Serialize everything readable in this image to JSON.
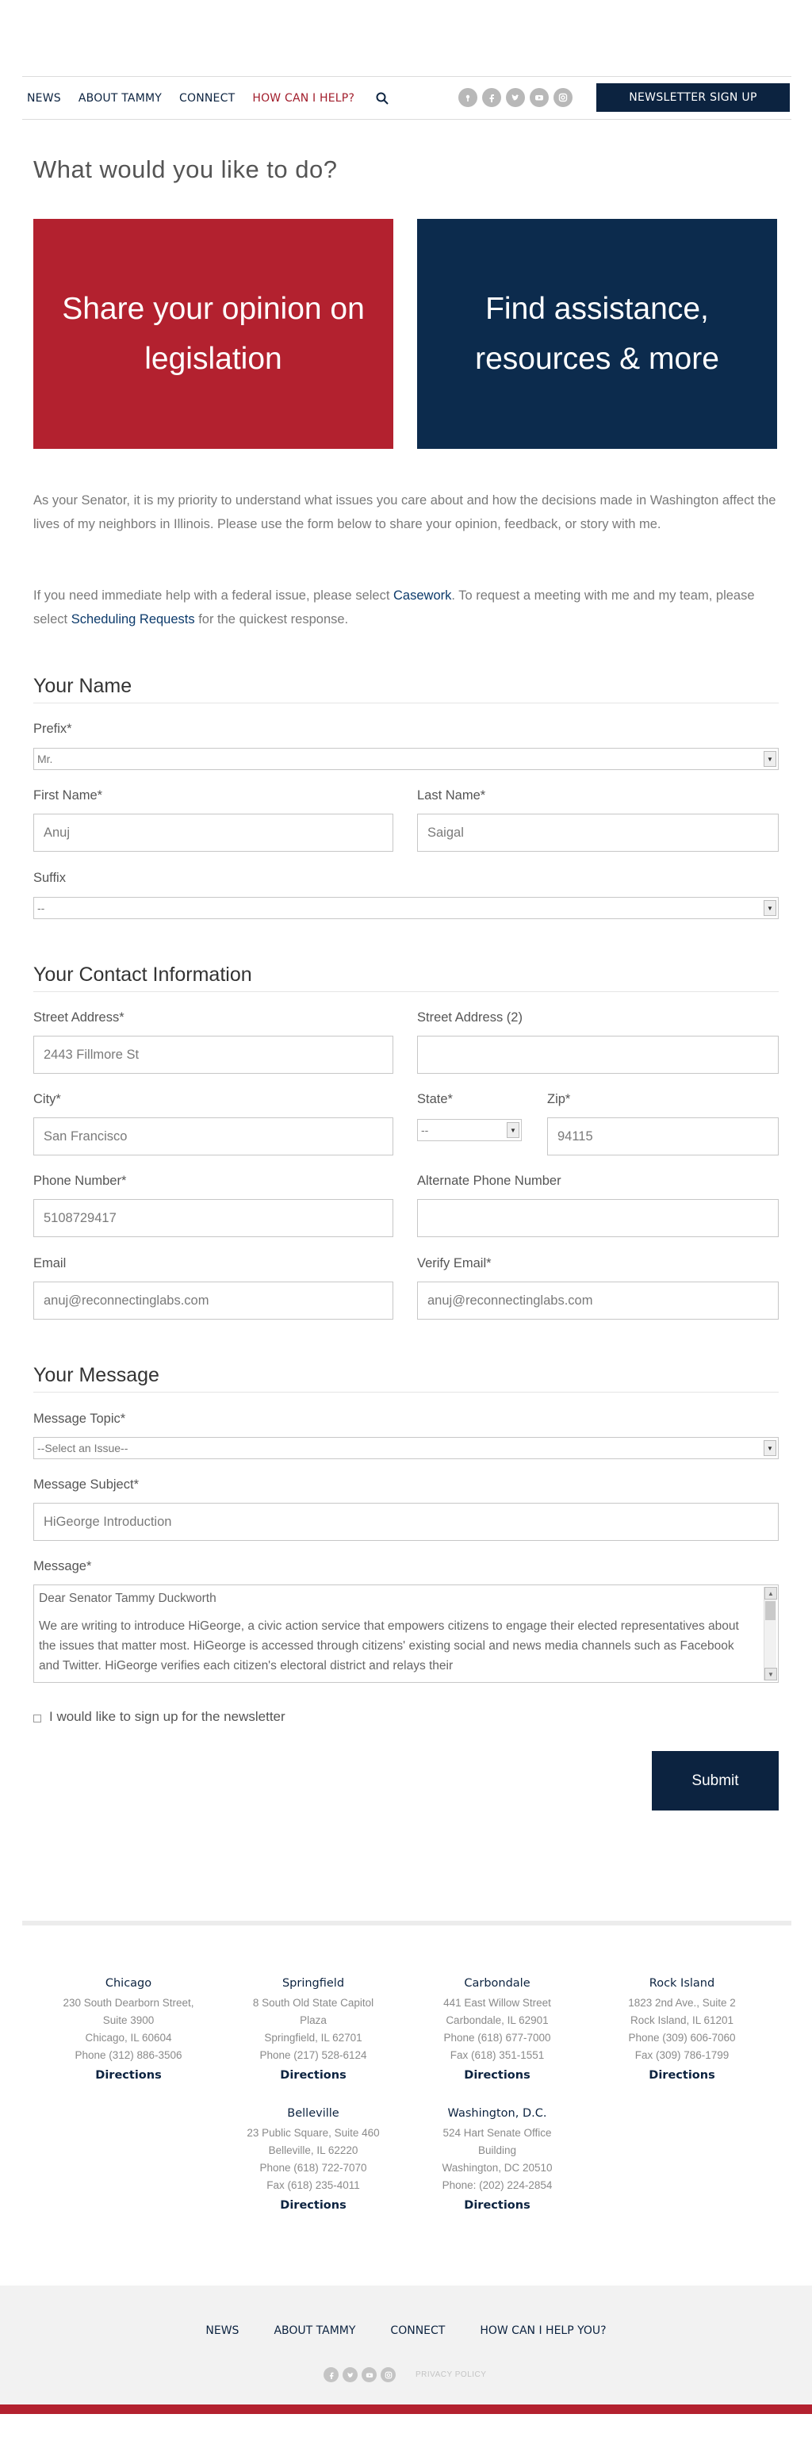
{
  "nav": {
    "links": [
      "NEWS",
      "ABOUT TAMMY",
      "CONNECT",
      "HOW CAN I HELP?"
    ],
    "newsletter_label": "NEWSLETTER SIGN UP",
    "social_icons": [
      "podcast-icon",
      "facebook-icon",
      "twitter-icon",
      "youtube-icon",
      "instagram-icon"
    ],
    "active_color": "#a11d2b"
  },
  "page_title": "What would you like to do?",
  "tiles": {
    "opinion": "Share your opinion on legislation",
    "assistance": "Find assistance, resources & more",
    "colors": {
      "opinion": "#b3212f",
      "assistance": "#0c2b4d"
    }
  },
  "intro": {
    "p1": "As your Senator, it is my priority to understand what issues you care about and how the decisions made in Washington affect the lives of my neighbors in Illinois. Please use the form below to share your opinion, feedback, or story with me.",
    "p2_before": "If you need immediate help with a federal issue, please select ",
    "p2_link1": "Casework",
    "p2_middle": ". To request a meeting with me and my team, please select ",
    "p2_link2": "Scheduling Requests",
    "p2_after": " for the quickest response."
  },
  "your_name": {
    "heading": "Your Name",
    "prefix_label": "Prefix*",
    "prefix_value": "Mr.",
    "first_label": "First Name*",
    "first_value": "Anuj",
    "last_label": "Last Name*",
    "last_value": "Saigal",
    "suffix_label": "Suffix",
    "suffix_value": "--"
  },
  "contact": {
    "heading": "Your Contact Information",
    "street_label": "Street Address*",
    "street_value": "2443 Fillmore St",
    "street2_label": "Street Address (2)",
    "street2_value": "",
    "city_label": "City*",
    "city_value": "San Francisco",
    "state_label": "State*",
    "state_value": "--",
    "zip_label": "Zip*",
    "zip_value": "94115",
    "phone_label": "Phone Number*",
    "phone_value": "5108729417",
    "alt_phone_label": "Alternate Phone Number",
    "alt_phone_value": "",
    "email_label": "Email",
    "email_value": "anuj@reconnectinglabs.com",
    "verify_label": "Verify Email*",
    "verify_value": "anuj@reconnectinglabs.com"
  },
  "message": {
    "heading": "Your Message",
    "topic_label": "Message Topic*",
    "topic_value": "--Select an Issue--",
    "subject_label": "Message Subject*",
    "subject_value": "HiGeorge Introduction",
    "body_label": "Message*",
    "body_greeting": "Dear Senator Tammy Duckworth",
    "body_text": "We are writing to introduce HiGeorge, a civic action service that empowers citizens to engage their elected representatives about the issues that matter most. HiGeorge is accessed through citizens' existing social and news media channels such as Facebook and Twitter.  HiGeorge verifies each citizen's electoral district and relays their",
    "newsletter_checkbox": "I would like to sign up for the newsletter",
    "submit_label": "Submit"
  },
  "offices": [
    {
      "city": "Chicago",
      "lines": [
        "230 South Dearborn Street,",
        "Suite 3900",
        "Chicago, IL 60604",
        "Phone (312) 886-3506"
      ],
      "directions": "Directions"
    },
    {
      "city": "Springfield",
      "lines": [
        "8 South Old State Capitol",
        "Plaza",
        "Springfield, IL 62701",
        "Phone (217) 528-6124"
      ],
      "directions": "Directions"
    },
    {
      "city": "Carbondale",
      "lines": [
        "441 East Willow Street",
        "Carbondale, IL 62901",
        "Phone (618) 677-7000",
        "Fax (618) 351-1551"
      ],
      "directions": "Directions"
    },
    {
      "city": "Rock Island",
      "lines": [
        "1823 2nd Ave., Suite 2",
        "Rock Island, IL 61201",
        "Phone (309) 606-7060",
        "Fax (309) 786-1799"
      ],
      "directions": "Directions"
    },
    {
      "city": "Belleville",
      "lines": [
        "23 Public Square, Suite 460",
        "Belleville, IL 62220",
        "Phone (618) 722-7070",
        "Fax (618) 235-4011"
      ],
      "directions": "Directions"
    },
    {
      "city": "Washington, D.C.",
      "lines": [
        "524 Hart Senate Office",
        "Building",
        "Washington, DC 20510",
        "Phone: (202) 224-2854"
      ],
      "directions": "Directions"
    }
  ],
  "footer": {
    "links": [
      "NEWS",
      "ABOUT TAMMY",
      "CONNECT",
      "HOW CAN I HELP YOU?"
    ],
    "social_icons": [
      "facebook-icon",
      "twitter-icon",
      "youtube-icon",
      "instagram-icon"
    ],
    "privacy": "PRIVACY POLICY",
    "accent_color": "#b3212f"
  }
}
